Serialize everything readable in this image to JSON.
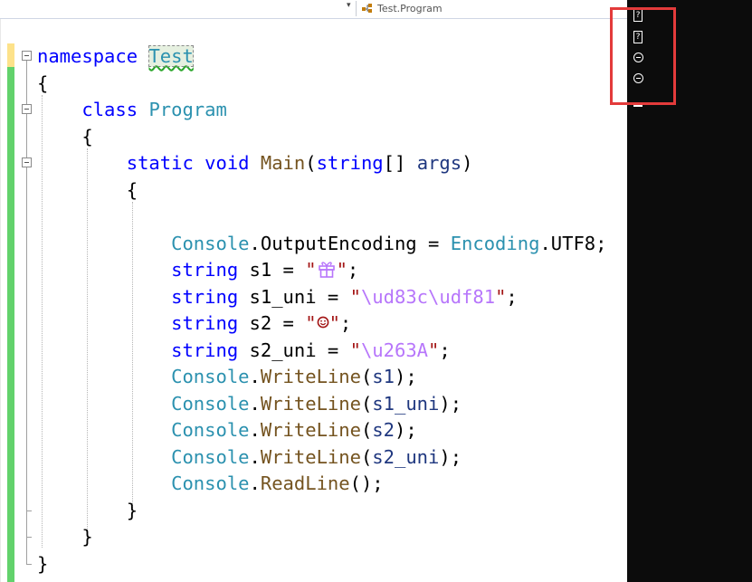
{
  "navbar": {
    "type_label": "Test.Program",
    "dropdown_icon": "chevron-down-icon",
    "class_icon": "class-icon"
  },
  "code": {
    "line1": {
      "kw": "namespace",
      "name": "Test"
    },
    "line2": {
      "brace": "{"
    },
    "line3": {
      "kw": "class",
      "name": "Program"
    },
    "line4": {
      "brace": "{"
    },
    "line5": {
      "kw1": "static",
      "kw2": "void",
      "method": "Main",
      "open": "(",
      "kw3": "string",
      "brackets": "[]",
      "param": "args",
      "close": ")"
    },
    "line6": {
      "brace": "{"
    },
    "line8": {
      "type1": "Console",
      "dot1": ".",
      "prop": "OutputEncoding",
      "eq": " = ",
      "type2": "Encoding",
      "dot2": ".",
      "member": "UTF8",
      "semi": ";"
    },
    "line9": {
      "kw": "string",
      "var": "s1",
      "eq": " = ",
      "q1": "\"",
      "q2": "\"",
      "semi": ";",
      "icon": "gift-icon"
    },
    "line10": {
      "kw": "string",
      "var": "s1_uni",
      "eq": " = ",
      "q1": "\"",
      "esc": "\\ud83c\\udf81",
      "q2": "\"",
      "semi": ";"
    },
    "line11": {
      "kw": "string",
      "var": "s2",
      "eq": " = ",
      "q1": "\"",
      "q2": "\"",
      "semi": ";",
      "icon": "smiley-icon"
    },
    "line12": {
      "kw": "string",
      "var": "s2_uni",
      "eq": " = ",
      "q1": "\"",
      "esc": "\\u263A",
      "q2": "\"",
      "semi": ";"
    },
    "line13": {
      "type": "Console",
      "dot": ".",
      "method": "WriteLine",
      "open": "(",
      "arg": "s1",
      "close": ");"
    },
    "line14": {
      "type": "Console",
      "dot": ".",
      "method": "WriteLine",
      "open": "(",
      "arg": "s1_uni",
      "close": ");"
    },
    "line15": {
      "type": "Console",
      "dot": ".",
      "method": "WriteLine",
      "open": "(",
      "arg": "s2",
      "close": ");"
    },
    "line16": {
      "type": "Console",
      "dot": ".",
      "method": "WriteLine",
      "open": "(",
      "arg": "s2_uni",
      "close": ");"
    },
    "line17": {
      "type": "Console",
      "dot": ".",
      "method": "ReadLine",
      "close": "();"
    },
    "line18": {
      "brace": "}"
    },
    "line19": {
      "brace": "}"
    },
    "line20": {
      "brace": "}"
    }
  },
  "console": {
    "line1": "?",
    "line2": "?",
    "line3_icon": "circle-glyph",
    "line4_icon": "circle-glyph"
  },
  "colors": {
    "keyword": "#0000ff",
    "type": "#2b91af",
    "method": "#74531f",
    "parameter": "#1f377f",
    "string": "#a31515",
    "escape": "#b776fb",
    "highlight_frame": "#e33b3b",
    "change_saved": "#62d26c",
    "change_unsaved": "#fde28a"
  }
}
